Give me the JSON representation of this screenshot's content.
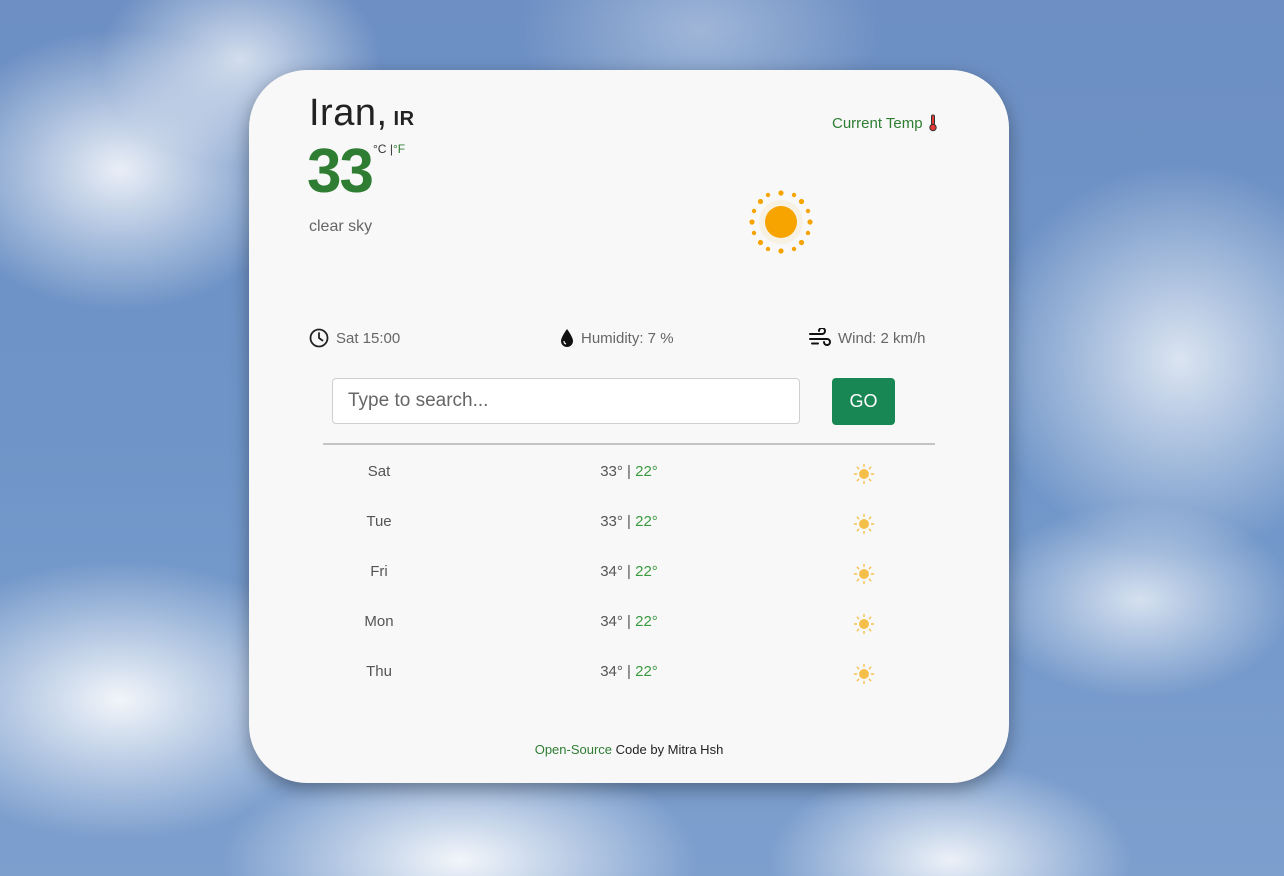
{
  "location": {
    "city": "Iran,",
    "country": "IR"
  },
  "current": {
    "temperature": "33",
    "unit_c": "°C",
    "unit_separator": "|",
    "unit_f": "°F",
    "description": "clear sky",
    "current_temp_label": "Current Temp",
    "weather_icon": "sun-icon"
  },
  "details": {
    "time": "Sat 15:00",
    "humidity": "Humidity: 7 %",
    "wind": "Wind: 2 km/h"
  },
  "search": {
    "placeholder": "Type to search...",
    "value": "",
    "button_label": "GO"
  },
  "forecast": [
    {
      "day": "Sat",
      "max": "33°",
      "sep": " | ",
      "min": "22°",
      "icon": "sun-icon"
    },
    {
      "day": "Tue",
      "max": "33°",
      "sep": " | ",
      "min": "22°",
      "icon": "sun-icon"
    },
    {
      "day": "Fri",
      "max": "34°",
      "sep": " | ",
      "min": "22°",
      "icon": "sun-icon"
    },
    {
      "day": "Mon",
      "max": "34°",
      "sep": " | ",
      "min": "22°",
      "icon": "sun-icon"
    },
    {
      "day": "Thu",
      "max": "34°",
      "sep": " | ",
      "min": "22°",
      "icon": "sun-icon"
    }
  ],
  "footer": {
    "link_text": "Open-Source",
    "rest_text": " Code by Mitra Hsh"
  },
  "colors": {
    "accent_green": "#2e7d32",
    "button_green": "#198754",
    "sun_orange": "#f7a400",
    "sun_small": "#f5c04a"
  }
}
